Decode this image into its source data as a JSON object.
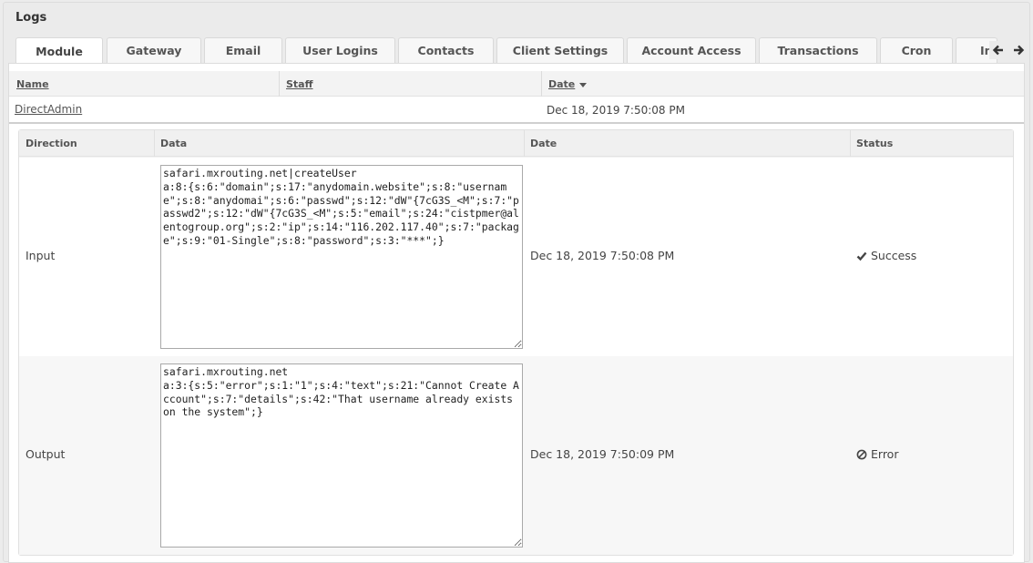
{
  "panel": {
    "title": "Logs"
  },
  "tabs": [
    {
      "label": "Module",
      "active": true
    },
    {
      "label": "Gateway"
    },
    {
      "label": "Email"
    },
    {
      "label": "User Logins"
    },
    {
      "label": "Contacts"
    },
    {
      "label": "Client Settings"
    },
    {
      "label": "Account Access"
    },
    {
      "label": "Transactions"
    },
    {
      "label": "Cron"
    },
    {
      "label": "In"
    }
  ],
  "list": {
    "columns": {
      "name": "Name",
      "staff": "Staff",
      "date": "Date"
    },
    "rows": [
      {
        "name": "DirectAdmin",
        "staff": "",
        "date": "Dec 18, 2019 7:50:08 PM"
      }
    ]
  },
  "detail": {
    "columns": {
      "direction": "Direction",
      "data": "Data",
      "date": "Date",
      "status": "Status"
    },
    "rows": [
      {
        "direction": "Input",
        "data": "safari.mxrouting.net|createUser\na:8:{s:6:\"domain\";s:17:\"anydomain.website\";s:8:\"username\";s:8:\"anydomai\";s:6:\"passwd\";s:12:\"dW\"{7cG3S_<M\";s:7:\"passwd2\";s:12:\"dW\"{7cG3S_<M\";s:5:\"email\";s:24:\"cistpmer@alentogroup.org\";s:2:\"ip\";s:14:\"116.202.117.40\";s:7:\"package\";s:9:\"01-Single\";s:8:\"password\";s:3:\"***\";}",
        "date": "Dec 18, 2019 7:50:08 PM",
        "status": "Success",
        "status_icon": "check-icon",
        "status_color": "#444444"
      },
      {
        "direction": "Output",
        "data": "safari.mxrouting.net\na:3:{s:5:\"error\";s:1:\"1\";s:4:\"text\";s:21:\"Cannot Create Account\";s:7:\"details\";s:42:\"That username already exists on the system\";}",
        "date": "Dec 18, 2019 7:50:09 PM",
        "status": "Error",
        "status_icon": "ban-icon",
        "status_color": "#444444"
      }
    ]
  }
}
